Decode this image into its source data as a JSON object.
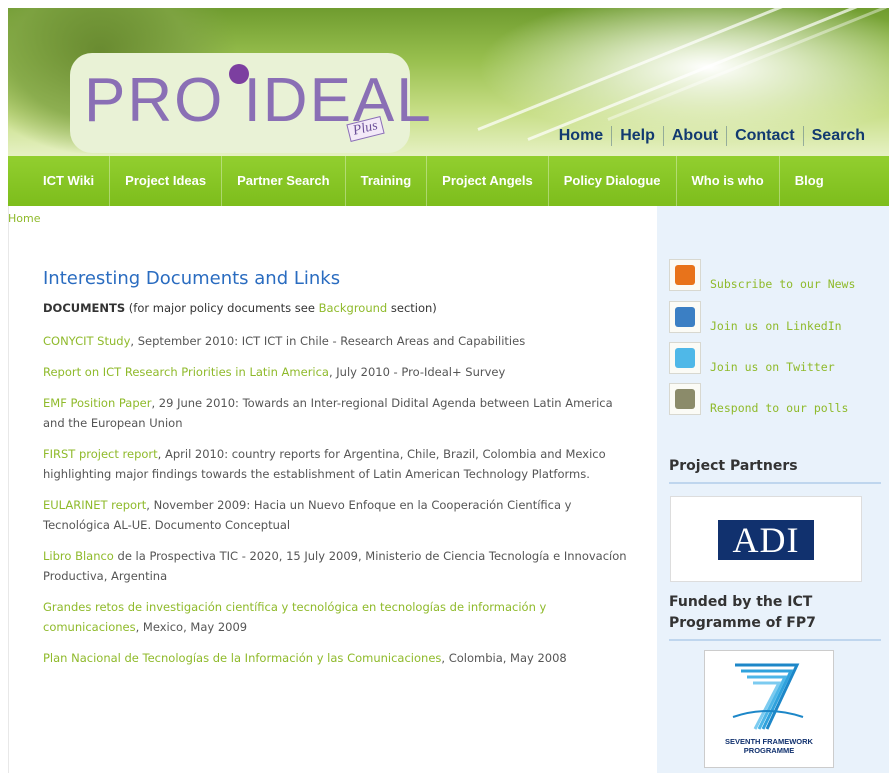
{
  "header": {
    "logo_text": "PRO IDEAL",
    "logo_suffix": "Plus",
    "topnav": [
      "Home",
      "Help",
      "About",
      "Contact",
      "Search"
    ]
  },
  "mainnav": [
    "ICT Wiki",
    "Project Ideas",
    "Partner Search",
    "Training",
    "Project Angels",
    "Policy Dialogue",
    "Who is who",
    "Blog"
  ],
  "breadcrumb": "Home",
  "main": {
    "title": "Interesting Documents and Links",
    "intro": {
      "bold": "DOCUMENTS",
      "before_link": " (for major policy documents see ",
      "link": "Background",
      "after_link": " section)"
    },
    "documents": [
      {
        "link": "CONYCIT Study",
        "text": ", September 2010: ICT ICT in Chile - Research Areas and Capabilities"
      },
      {
        "link": "Report on ICT Research Priorities in Latin America",
        "text": ", July 2010 - Pro-Ideal+ Survey"
      },
      {
        "link": "EMF Position Paper",
        "text": ", 29 June 2010: Towards an Inter-regional Didital Agenda between Latin America and the European Union"
      },
      {
        "link": "FIRST project report",
        "text": ", April 2010: country reports for Argentina, Chile, Brazil, Colombia and Mexico highlighting major findings towards the establishment of Latin American Technology Platforms."
      },
      {
        "link": "EULARINET report",
        "text": ", November 2009: Hacia un Nuevo Enfoque en la Cooperación Científica y Tecnológica AL-UE. Documento Conceptual"
      },
      {
        "link": "Libro Blanco",
        "text": " de la Prospectiva TIC - 2020, 15 July 2009, Ministerio de Ciencia Tecnología e Innovacíon Productiva, Argentina"
      },
      {
        "link": "Grandes retos de investigación científica y tecnológica en tecnologías de información y comunicaciones",
        "text": ", Mexico, May 2009"
      },
      {
        "link": "Plan Nacional de Tecnologías de la Información y las Comunicaciones",
        "text": ", Colombia, May 2008"
      }
    ]
  },
  "sidebar": {
    "social": [
      {
        "label": "Subscribe to our News",
        "icon": "rss-icon",
        "color": "#e8731b"
      },
      {
        "label": "Join us on LinkedIn",
        "icon": "linkedin-icon",
        "color": "#3b7fc4"
      },
      {
        "label": "Join us on Twitter",
        "icon": "twitter-icon",
        "color": "#4fb8e8"
      },
      {
        "label": "Respond to our polls",
        "icon": "poll-icon",
        "color": "#8b8b6a"
      }
    ],
    "partners_heading": "Project Partners",
    "partner_logo": "ADI",
    "funded_heading": "Funded by the ICT Programme of FP7",
    "fp7_text": "SEVENTH FRAMEWORK PROGRAMME"
  },
  "colors": {
    "nav_green": "#7dbd1c",
    "link_green": "#8fba2b",
    "title_blue": "#2a6cc0",
    "sidebar_bg": "#e9f2fb"
  }
}
